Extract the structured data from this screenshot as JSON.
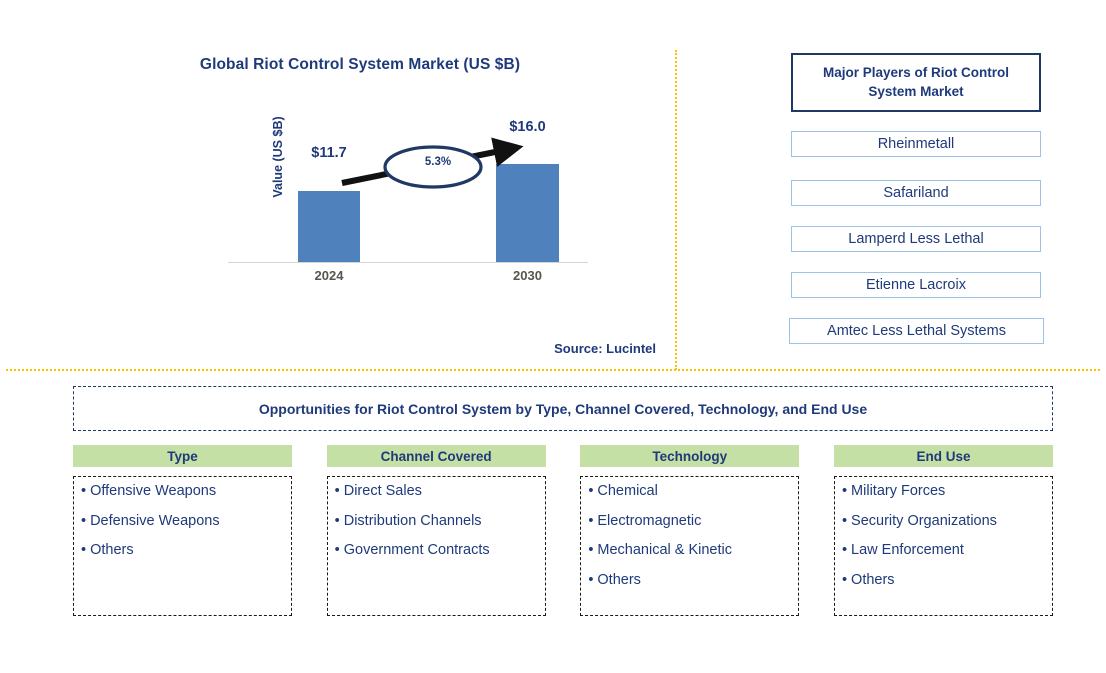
{
  "chart_panel": {
    "title": "Global Riot Control System Market (US $B)",
    "source": "Source: Lucintel"
  },
  "chart_data": {
    "type": "bar",
    "title": "Global Riot Control System Market (US $B)",
    "xlabel": "",
    "ylabel": "Value (US $B)",
    "categories": [
      "2024",
      "2030"
    ],
    "values": [
      11.7,
      16.0
    ],
    "value_labels": [
      "$11.7",
      "$16.0"
    ],
    "ylim": [
      0,
      18
    ],
    "grid": false,
    "legend": null,
    "bar_color": "#4F81BD",
    "annotations": [
      {
        "text": "5.3%",
        "type": "cagr-callout",
        "shape": "ellipse",
        "from": "2024",
        "to": "2030"
      }
    ]
  },
  "players": {
    "header": "Major Players of Riot Control System Market",
    "items": [
      "Rheinmetall",
      "Safariland",
      "Lamperd Less Lethal",
      "Etienne Lacroix",
      "Amtec Less Lethal Systems"
    ]
  },
  "opportunities": {
    "header": "Opportunities for Riot Control System by Type, Channel Covered, Technology, and End Use",
    "columns": [
      {
        "title": "Type",
        "items": [
          "Offensive Weapons",
          "Defensive Weapons",
          "Others"
        ]
      },
      {
        "title": "Channel Covered",
        "items": [
          "Direct Sales",
          "Distribution Channels",
          "Government Contracts"
        ]
      },
      {
        "title": "Technology",
        "items": [
          "Chemical",
          "Electromagnetic",
          "Mechanical & Kinetic",
          "Others"
        ]
      },
      {
        "title": "End Use",
        "items": [
          "Military Forces",
          "Security Organizations",
          "Law Enforcement",
          "Others"
        ]
      }
    ]
  },
  "colors": {
    "navy": "#1F3A7A",
    "bar_blue": "#4F81BD",
    "divider_gold": "#FFC000",
    "header_green": "#C5E0A5",
    "player_border": "#9DC3E6"
  },
  "bullet": "•"
}
